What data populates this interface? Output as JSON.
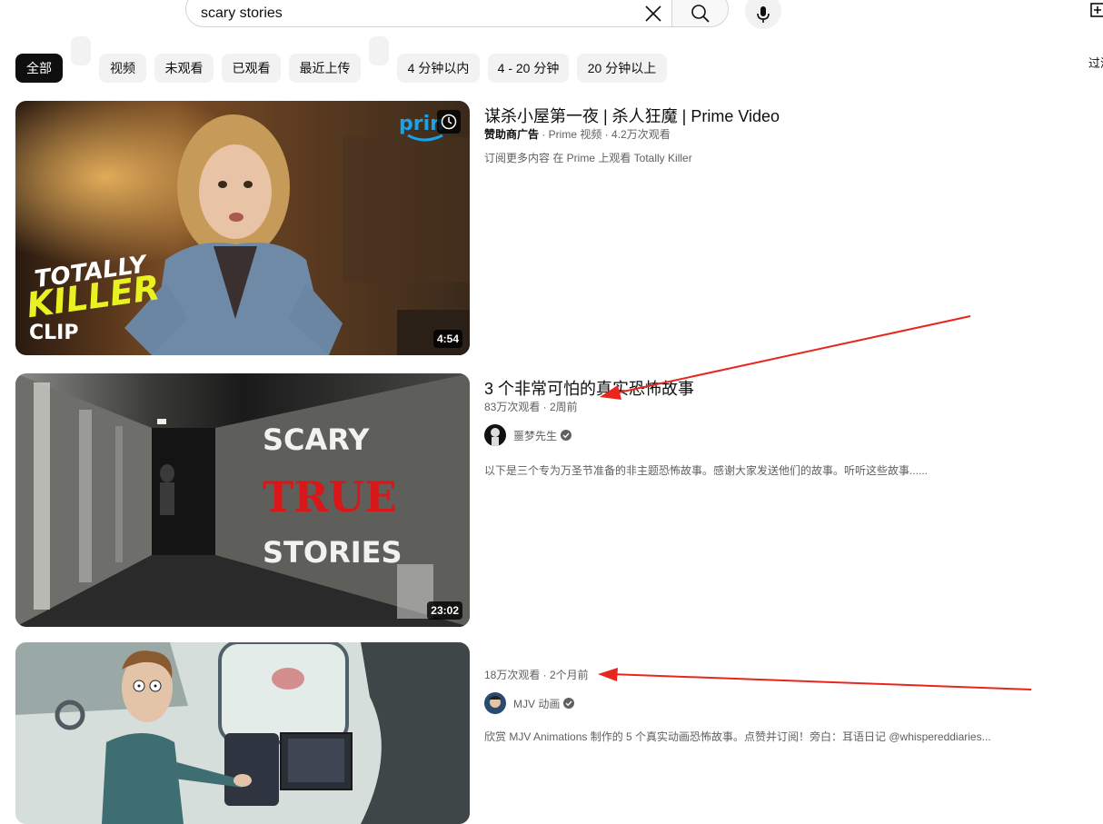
{
  "search": {
    "query": "scary stories"
  },
  "header": {
    "filter_label": "过滤"
  },
  "chips": [
    {
      "label": "全部",
      "active": true
    },
    {
      "label": "视频"
    },
    {
      "label": "未观看"
    },
    {
      "label": "已观看"
    },
    {
      "label": "最近上传"
    },
    {
      "label": "4 分钟以内"
    },
    {
      "label": "4 - 20 分钟"
    },
    {
      "label": "20 分钟以上"
    }
  ],
  "results": [
    {
      "title": "谋杀小屋第一夜 | 杀人狂魔 | Prime Video",
      "sponsor": "赞助商广告",
      "meta": " · Prime 视频 · 4.2万次观看",
      "description": "订阅更多内容 在 Prime 上观看 Totally Killer",
      "duration": "4:54",
      "thumb_text_1": "TOTALLY",
      "thumb_text_2": "KILLER",
      "thumb_text_3": "CLIP",
      "thumb_logo": "prin"
    },
    {
      "title": "3 个非常可怕的真实恐怖故事",
      "meta": "83万次观看 · 2周前",
      "channel": "噩梦先生",
      "description": "以下是三个专为万圣节准备的非主题恐怖故事。感谢大家发送他们的故事。听听这些故事......",
      "duration": "23:02",
      "thumb_text_1": "SCARY",
      "thumb_text_2": "TRUE",
      "thumb_text_3": "STORIES"
    },
    {
      "meta": "18万次观看 · 2个月前",
      "channel": "MJV 动画",
      "description": "欣赏 MJV Animations 制作的 5 个真实动画恐怖故事。点赞并订阅！旁白：耳语日记 @whispereddiaries..."
    }
  ],
  "colors": {
    "chip_bg": "#f2f2f2",
    "chip_active_bg": "#0f0f0f",
    "meta_text": "#606060",
    "annotation_arrow": "#e8261c"
  }
}
